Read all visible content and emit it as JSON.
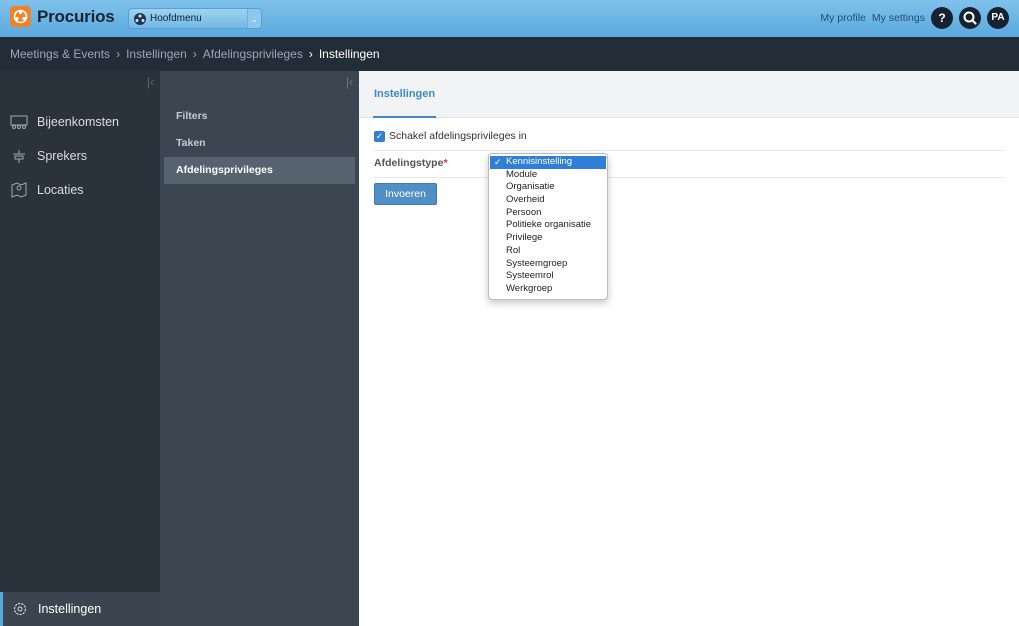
{
  "app": {
    "name": "Procurios",
    "main_menu_label": "Hoofdmenu",
    "accent_color": "#5aa9dd",
    "brand_color": "#f0822a"
  },
  "header": {
    "my_profile": "My profile",
    "my_settings": "My settings",
    "help_label": "?",
    "search_label": "Q",
    "avatar_initials": "PA"
  },
  "breadcrumb": {
    "items": [
      "Meetings & Events",
      "Instellingen",
      "Afdelingsprivileges"
    ],
    "current": "Instellingen",
    "separator": "›"
  },
  "sidebar": {
    "collapse_icon": "collapse-icon",
    "items": [
      {
        "label": "Bijeenkomsten",
        "icon": "people-icon"
      },
      {
        "label": "Sprekers",
        "icon": "podium-icon"
      },
      {
        "label": "Locaties",
        "icon": "map-icon"
      }
    ],
    "bottom_item": {
      "label": "Instellingen",
      "icon": "gear-icon"
    }
  },
  "subnav": {
    "items": [
      {
        "label": "Filters"
      },
      {
        "label": "Taken"
      },
      {
        "label": "Afdelingsprivileges",
        "active": true
      }
    ]
  },
  "main": {
    "tab_label": "Instellingen",
    "checkbox_label": "Schakel afdelingsprivileges in",
    "checkbox_checked": true,
    "field_label": "Afdelingstype",
    "required_mark": "*",
    "submit_label": "Invoeren"
  },
  "dropdown": {
    "selected": "Kennisinstelling",
    "check_mark": "✓",
    "options": [
      "Kennisinstelling",
      "Module",
      "Organisatie",
      "Overheid",
      "Persoon",
      "Politieke organisatie",
      "Privilege",
      "Rol",
      "Systeemgroep",
      "Systeemrol",
      "Werkgroep"
    ]
  }
}
